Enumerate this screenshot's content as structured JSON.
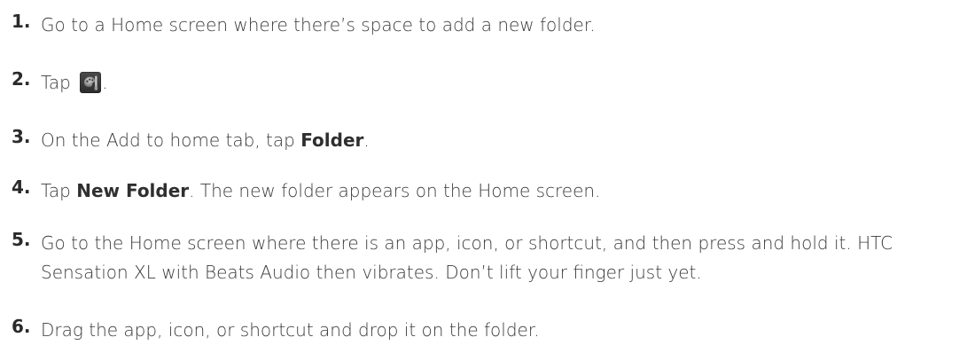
{
  "steps": [
    {
      "number": "1.",
      "text": "Go to a Home screen where there’s space to add a new folder."
    },
    {
      "number": "2.",
      "before_icon": "Tap",
      "icon": "personalize-icon",
      "after_icon": "."
    },
    {
      "number": "3.",
      "prefix": "On the Add to home tab, tap",
      "strong": "Folder",
      "suffix": "."
    },
    {
      "number": "4.",
      "prefix": "Tap",
      "strong": "New Folder",
      "suffix": ". The new folder appears on the Home screen."
    },
    {
      "number": "5.",
      "text": "Go to the Home screen where there is an app, icon, or shortcut, and then press and hold it. HTC Sensation XL with Beats Audio then vibrates. Don’t lift your finger just yet."
    },
    {
      "number": "6.",
      "text": "Drag the app, icon, or shortcut and drop it on the folder."
    }
  ]
}
